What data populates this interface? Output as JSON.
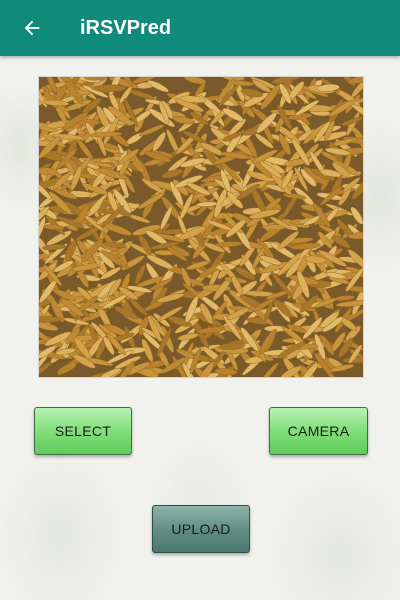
{
  "appbar": {
    "title": "iRSVPred",
    "back_icon": "arrow-left-icon",
    "color": "#0f8a7b"
  },
  "preview_image": {
    "subject": "rice grains",
    "grain_color": "#c8953c",
    "background_color": "#e9e2d2"
  },
  "buttons": {
    "select_label": "SELECT",
    "camera_label": "CAMERA",
    "upload_label": "UPLOAD"
  }
}
